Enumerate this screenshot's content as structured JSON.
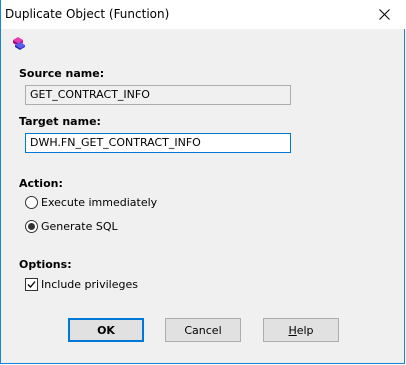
{
  "window": {
    "title": "Duplicate Object (Function)"
  },
  "source": {
    "label": "Source name:",
    "value": "GET_CONTRACT_INFO"
  },
  "target": {
    "label": "Target name:",
    "value": "DWH.FN_GET_CONTRACT_INFO"
  },
  "action": {
    "label": "Action:",
    "options": [
      {
        "label": "Execute immediately",
        "selected": false
      },
      {
        "label": "Generate SQL",
        "selected": true
      }
    ]
  },
  "options": {
    "label": "Options:",
    "include_privileges": {
      "label": "Include privileges",
      "checked": true
    }
  },
  "buttons": {
    "ok": "OK",
    "cancel": "Cancel",
    "help_first": "H",
    "help_rest": "elp"
  },
  "colors": {
    "accent": "#0078d7",
    "icon_magenta": "#c0188c",
    "icon_blue": "#3a3ad8"
  },
  "icons": {
    "app": "object-stack-icon",
    "close": "close-icon"
  }
}
